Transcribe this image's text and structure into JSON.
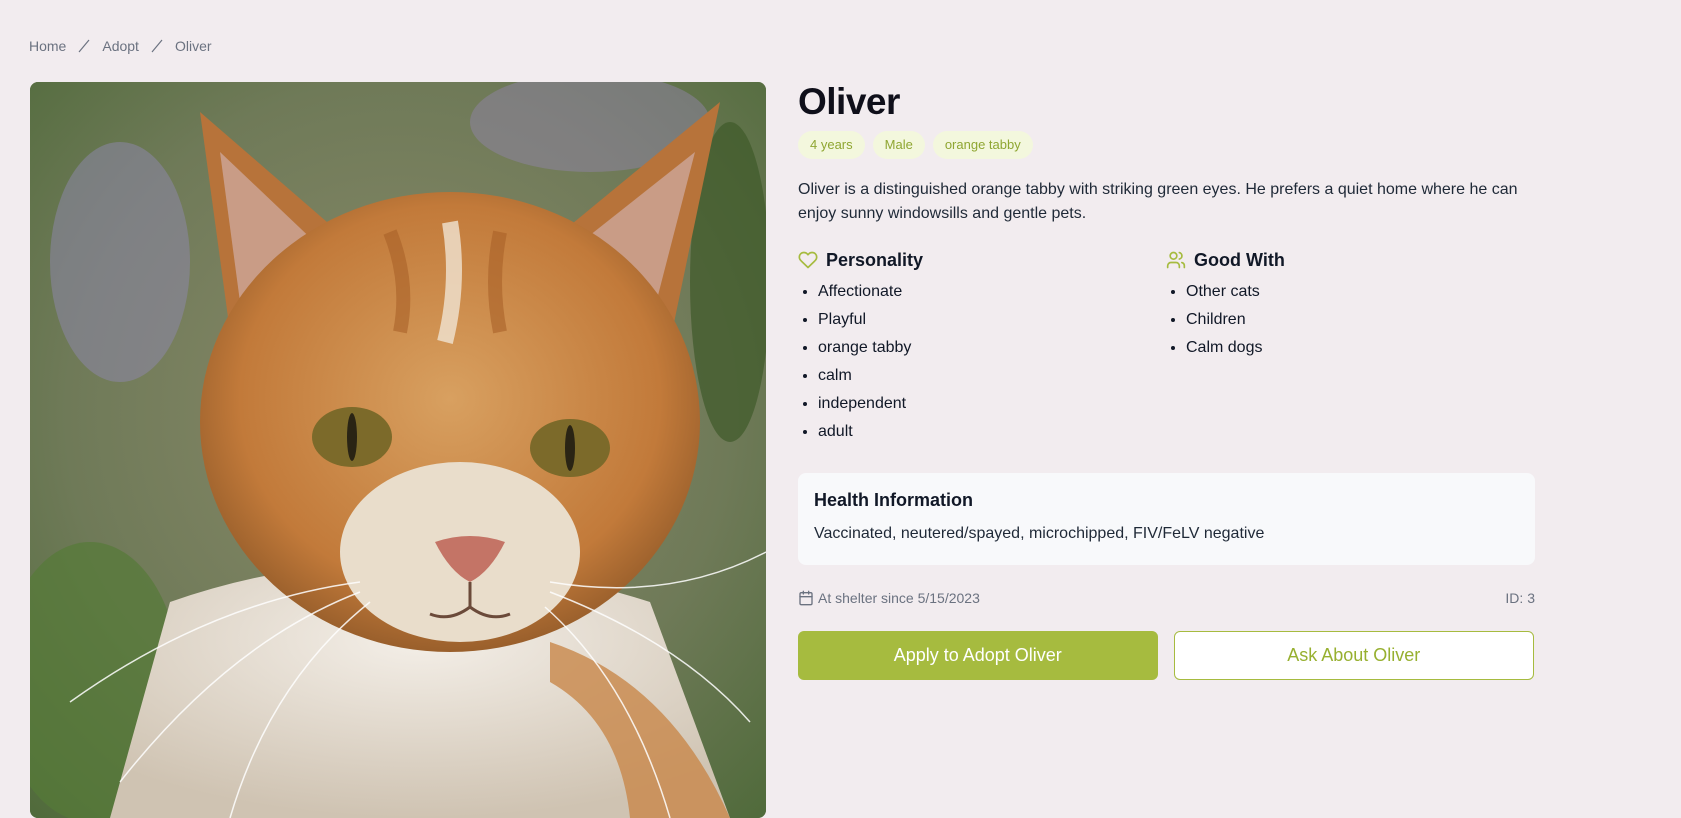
{
  "breadcrumb": {
    "home": "Home",
    "adopt": "Adopt",
    "current": "Oliver"
  },
  "pet": {
    "name": "Oliver",
    "tags": [
      "4 years",
      "Male",
      "orange tabby"
    ],
    "description": "Oliver is a distinguished orange tabby with striking green eyes. He prefers a quiet home where he can enjoy sunny windowsills and gentle pets.",
    "personality": {
      "title": "Personality",
      "icon": "heart-icon",
      "items": [
        "Affectionate",
        "Playful",
        "orange tabby",
        "calm",
        "independent",
        "adult"
      ]
    },
    "good_with": {
      "title": "Good With",
      "icon": "users-icon",
      "items": [
        "Other cats",
        "Children",
        "Calm dogs"
      ]
    },
    "health": {
      "title": "Health Information",
      "text": "Vaccinated, neutered/spayed, microchipped, FIV/FeLV negative"
    },
    "since": "At shelter since 5/15/2023",
    "id_label": "ID: 3"
  },
  "actions": {
    "apply": "Apply to Adopt Oliver",
    "ask": "Ask About Oliver"
  },
  "colors": {
    "accent": "#a6bb3f",
    "tag_bg": "#f3f7dd",
    "tag_text": "#8fa632",
    "page_bg": "#f2ecef"
  }
}
